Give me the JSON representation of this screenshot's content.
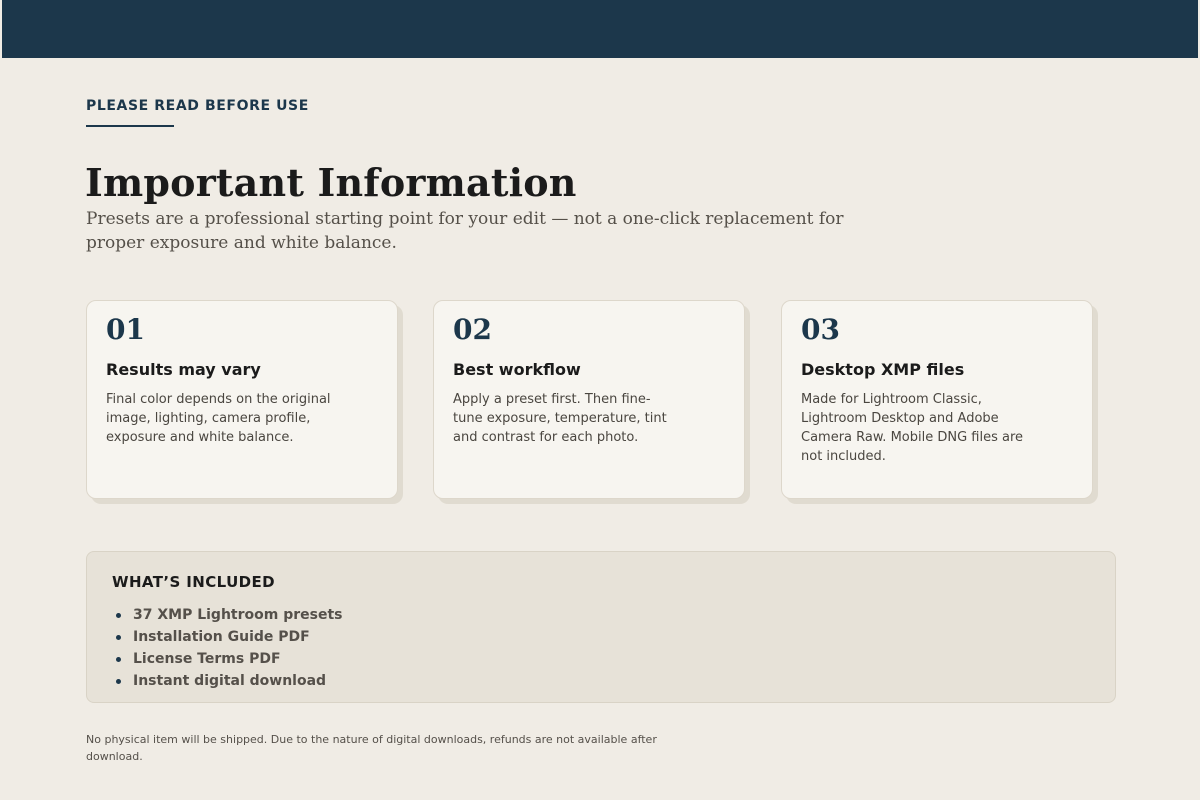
{
  "header": {
    "eyebrow": "PLEASE READ BEFORE USE",
    "title": "Important Information",
    "subtitle": "Presets are a professional starting point for your edit — not a one-click replacement for proper exposure and white balance."
  },
  "cards": [
    {
      "number": "01",
      "title": "Results may vary",
      "body": "Final color depends on the original image, lighting, camera profile, exposure and white balance."
    },
    {
      "number": "02",
      "title": "Best workflow",
      "body": "Apply a preset first. Then fine-tune exposure, temperature, tint and contrast for each photo."
    },
    {
      "number": "03",
      "title": "Desktop XMP files",
      "body": "Made for Lightroom Classic, Lightroom Desktop and Adobe Camera Raw. Mobile DNG files are not included."
    }
  ],
  "included": {
    "title": "WHAT’S INCLUDED",
    "items": [
      "37 XMP Lightroom presets",
      "Installation Guide PDF",
      "License Terms PDF",
      "Instant digital download"
    ]
  },
  "footnote": "No physical item will be shipped. Due to the nature of digital downloads, refunds are not available after download.",
  "colors": {
    "accent": "#1c374b",
    "background": "#f0ece5",
    "card": "#f7f5f0",
    "panel": "#e7e2d8"
  }
}
